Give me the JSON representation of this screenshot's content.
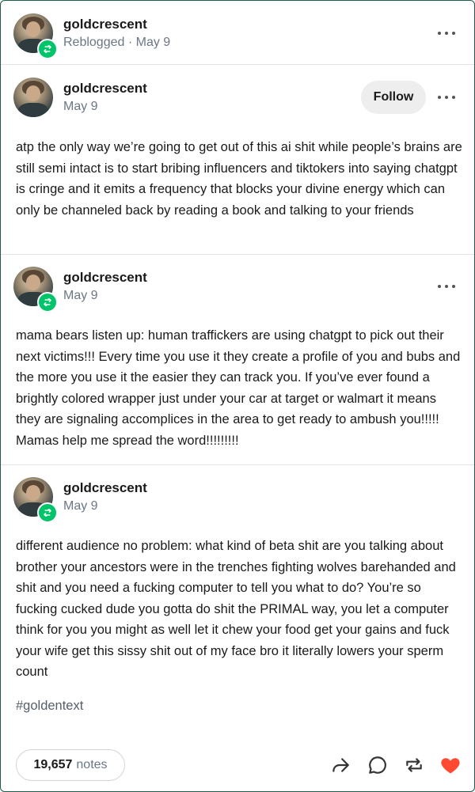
{
  "reblog_header": {
    "username": "goldcrescent",
    "meta": "Reblogged · May 9"
  },
  "posts": [
    {
      "username": "goldcrescent",
      "date": "May 9",
      "text": "atp the only way we’re going to get out of this ai shit while people’s brains are still semi intact is to start bribing influencers and tiktokers into saying chatgpt is cringe and it emits a frequency that blocks your divine energy which can only be channeled back by reading a book and talking to your friends"
    },
    {
      "username": "goldcrescent",
      "date": "May 9",
      "text": "mama bears listen up: human traffickers are using chatgpt to pick out their next victims!!! Every time you use it they create a profile of you and bubs and the more you use it the easier they can track you. If you’ve ever found a brightly colored wrapper just under your car at target or walmart it means they are signaling accomplices in the area to get ready to ambush you!!!!! Mamas help me spread the word!!!!!!!!!"
    },
    {
      "username": "goldcrescent",
      "date": "May 9",
      "text": "different audience no problem: what kind of beta shit are you talking about brother your ancestors were in the trenches fighting wolves barehanded and shit and you need a fucking computer to tell you what to do? You’re so fucking cucked dude you gotta do shit the PRIMAL way, you let a computer think for you you might as well let it chew your food get your gains and fuck your wife get this sissy shit out of my face bro it literally lowers your sperm count"
    }
  ],
  "follow_label": "Follow",
  "tag": "#goldentext",
  "notes": {
    "count": "19,657",
    "label": "notes"
  },
  "icons": {
    "share": "share-icon",
    "reply": "reply-icon",
    "reblog": "reblog-icon",
    "like": "heart-icon",
    "more": "more-options-icon"
  },
  "colors": {
    "reblog_badge": "#00c46a",
    "like": "#ff4930",
    "border": "#1d5c4b"
  }
}
